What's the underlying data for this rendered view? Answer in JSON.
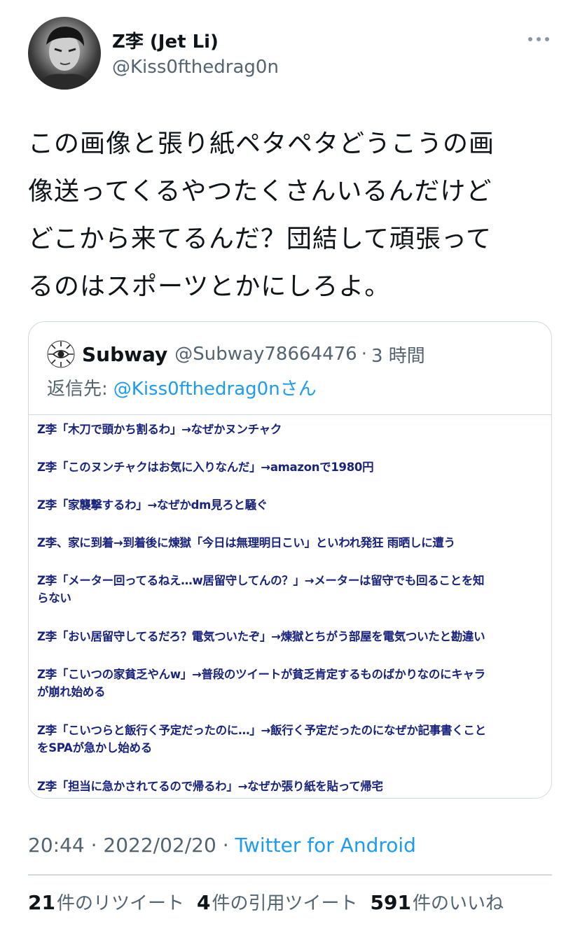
{
  "author": {
    "display_name": "Z李 (Jet Li)",
    "handle": "@Kiss0fthedrag0n"
  },
  "tweet": {
    "lines": [
      "この画像と張り紙ペタペタどうこうの画",
      "像送ってくるやつたくさんいるんだけど",
      "どこから来てるんだ？団結して頑張って",
      "るのはスポーツとかにしろよ。"
    ]
  },
  "quote": {
    "name": "Subway",
    "handle": "@Subway78664476",
    "separator": "·",
    "time": "3 時間",
    "reply_prefix": "返信先:",
    "reply_mention": "@Kiss0fthedrag0n",
    "reply_suffix": "さん",
    "image_lines": [
      "Z李「木刀で頭かち割るわ」→なぜかヌンチャク",
      "Z李「このヌンチャクはお気に入りなんだ」→amazonで1980円",
      "Z李「家襲撃するわ」→なぜかdm見ろと騒ぐ",
      "Z李、家に到着→到着後に煉獄「今日は無理明日こい」といわれ発狂 雨晒しに遭う",
      "Z李「メーター回ってるねえ…w居留守してんの？」→メーターは留守でも回ることを知",
      "らない",
      "Z李「おい居留守してるだろ？電気ついたぞ」→煉獄とちがう部屋を電気ついたと勘違い",
      "Z李「こいつの家貧乏やんw」→普段のツイートが貧乏肯定するものばかりなのにキャラ",
      "が崩れ始める",
      "Z李「こいつらと飯行く予定だったのに…」→飯行く予定だったのになぜか記事書くこと",
      "をSPAが急かし始める",
      "Z李「担当に急かされてるので帰るわ」→なぜか張り紙を貼って帰宅"
    ]
  },
  "meta": {
    "time": "20:44",
    "date": "2022/02/20",
    "separator": "·",
    "source": "Twitter for Android"
  },
  "stats": {
    "retweets": "21",
    "retweets_label": "件のリツイート",
    "quotes": "4",
    "quotes_label": "件の引用ツイート",
    "likes": "591",
    "likes_label": "件のいいね"
  }
}
